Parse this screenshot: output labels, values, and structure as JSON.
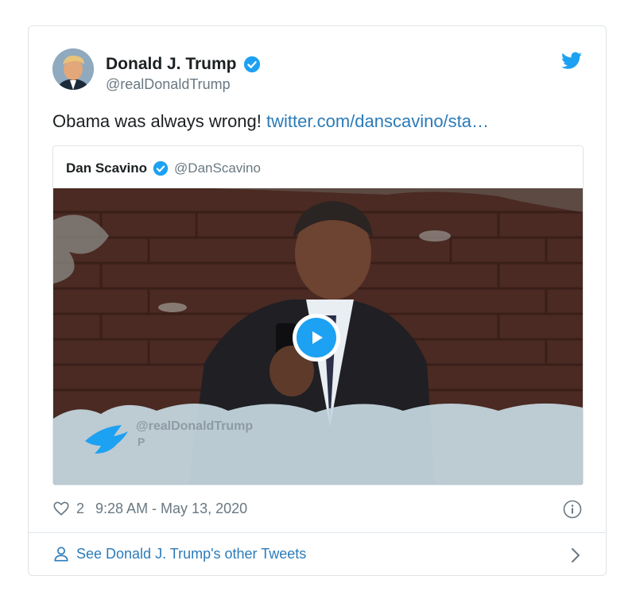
{
  "tweet": {
    "author_name": "Donald J. Trump",
    "author_handle": "@realDonaldTrump",
    "text": "Obama was always wrong!",
    "link_text": "twitter.com/danscavino/sta…",
    "likes": "2",
    "timestamp": "9:28 AM - May 13, 2020"
  },
  "quote": {
    "name": "Dan Scavino",
    "handle": "@DanScavino",
    "overlay_handle": "@realDonaldTrump",
    "overlay_sub": "P"
  },
  "footer": {
    "see_more": "See Donald J. Trump's other Tweets"
  },
  "icons": {
    "verified": "verified-badge-icon",
    "bird": "twitter-bird-icon",
    "play": "play-icon",
    "heart": "heart-icon",
    "info": "info-icon",
    "person": "person-icon",
    "chevron": "chevron-right-icon"
  },
  "colors": {
    "brand_blue": "#1da1f2",
    "link_blue": "#2b7bb9",
    "secondary_text": "#697882"
  }
}
